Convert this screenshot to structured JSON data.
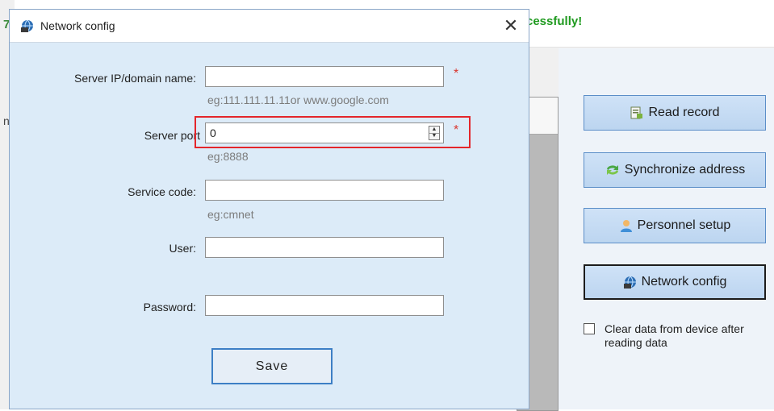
{
  "background": {
    "status_text": "cessfully!",
    "edge_char_1": "7",
    "edge_char_2": "n",
    "buttons": {
      "read_record": "Read record",
      "synchronize_address": "Synchronize address",
      "personnel_setup": "Personnel setup",
      "network_config": "Network config"
    },
    "clear_data_label": "Clear data from device after reading data",
    "clear_data_checked": false
  },
  "dialog": {
    "title": "Network config",
    "close_glyph": "✕",
    "fields": {
      "server_ip": {
        "label": "Server IP/domain name:",
        "value": "",
        "hint": "eg:111.111.11.11or www.google.com",
        "required_mark": "*"
      },
      "server_port": {
        "label": "Server port",
        "value": "0",
        "hint": "eg:8888",
        "required_mark": "*"
      },
      "service_code": {
        "label": "Service code:",
        "value": "",
        "hint": "eg:cmnet"
      },
      "user": {
        "label": "User:",
        "value": ""
      },
      "password": {
        "label": "Password:",
        "value": ""
      }
    },
    "save_label": "Save",
    "highlight_color": "#e4262b"
  },
  "icons": {
    "network": "network-icon",
    "record": "record-icon",
    "sync": "sync-icon",
    "person": "person-icon",
    "spinner_up": "▲",
    "spinner_down": "▼"
  },
  "colors": {
    "dialog_bg": "#dcebf8",
    "accent": "#3d7fc5",
    "status_green": "#1f9a1f",
    "required": "#d9362f"
  }
}
